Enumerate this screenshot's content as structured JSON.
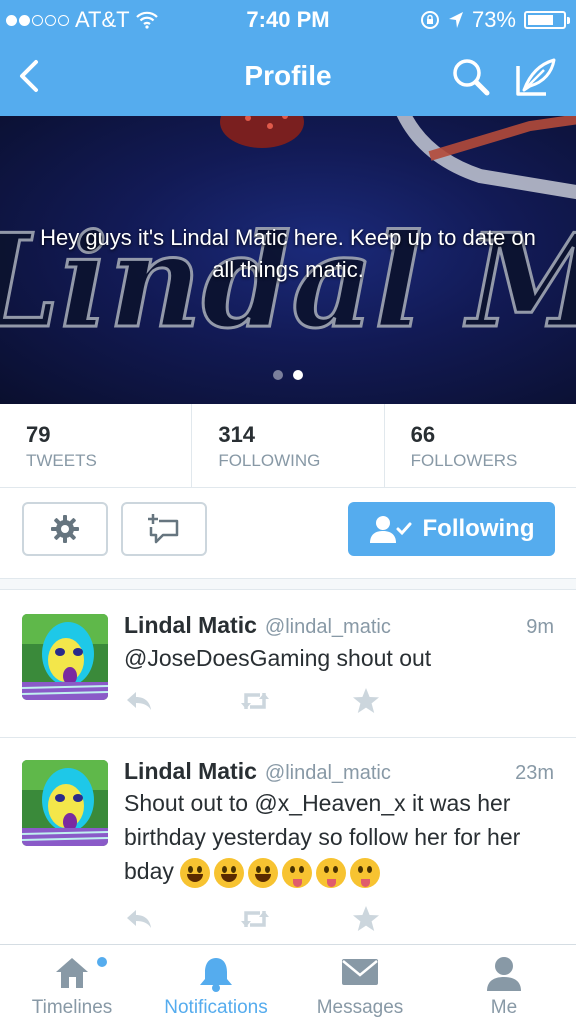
{
  "status_bar": {
    "carrier": "AT&T",
    "time": "7:40 PM",
    "battery": "73%",
    "battery_level": 0.73,
    "signal_bars_filled": 2,
    "signal_bars_total": 5
  },
  "nav": {
    "title": "Profile"
  },
  "header": {
    "bio": "Hey guys it's Lindal Matic here. Keep up to date on all things matic.",
    "banner_text": "Lindal Matic",
    "pages": 2,
    "active_page": 2
  },
  "stats": [
    {
      "value": "79",
      "label": "TWEETS"
    },
    {
      "value": "314",
      "label": "FOLLOWING"
    },
    {
      "value": "66",
      "label": "FOLLOWERS"
    }
  ],
  "actions": {
    "follow_label": "Following"
  },
  "tweets": [
    {
      "name": "Lindal Matic",
      "handle": "@lindal_matic",
      "time": "9m",
      "text": "@JoseDoesGaming shout out"
    },
    {
      "name": "Lindal Matic",
      "handle": "@lindal_matic",
      "time": "23m",
      "text": "Shout out to @x_Heaven_x it was her birthday yesterday so follow her for her bday",
      "emojis": [
        "grin",
        "smile",
        "grin",
        "wink-tongue",
        "squint-tongue",
        "tongue"
      ]
    }
  ],
  "tabs": [
    {
      "label": "Timelines",
      "icon": "home-icon",
      "active": false
    },
    {
      "label": "Notifications",
      "icon": "bell-icon",
      "active": true
    },
    {
      "label": "Messages",
      "icon": "envelope-icon",
      "active": false
    },
    {
      "label": "Me",
      "icon": "person-icon",
      "active": false
    }
  ],
  "colors": {
    "accent": "#55acee",
    "muted": "#8899a6",
    "text": "#292f33",
    "border": "#e1e8ed"
  }
}
